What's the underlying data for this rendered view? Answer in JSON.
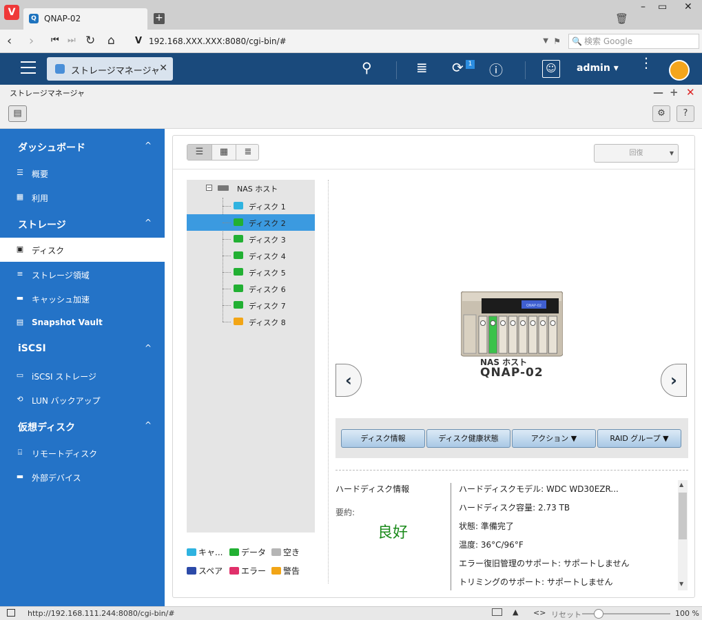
{
  "browser": {
    "tab_title": "QNAP-02",
    "url": "192.168.XXX.XXX:8080/cgi-bin/#",
    "search_placeholder": "検索 Google"
  },
  "topbar": {
    "app_tab_label": "ストレージマネージャ",
    "notification_count": "1",
    "user": "admin"
  },
  "app": {
    "title": "ストレージマネージャ"
  },
  "sidebar": {
    "sections": [
      {
        "label": "ダッシュボード",
        "items": [
          {
            "label": "概要",
            "icon": "list-icon"
          },
          {
            "label": "利用",
            "icon": "chart-icon"
          }
        ]
      },
      {
        "label": "ストレージ",
        "items": [
          {
            "label": "ディスク",
            "icon": "disk-icon"
          },
          {
            "label": "ストレージ領域",
            "icon": "storage-icon"
          },
          {
            "label": "キャッシュ加速",
            "icon": "cache-icon"
          },
          {
            "label": "Snapshot Vault",
            "icon": "snapshot-icon"
          }
        ]
      },
      {
        "label": "iSCSI",
        "items": [
          {
            "label": "iSCSI ストレージ",
            "icon": "iscsi-icon"
          },
          {
            "label": "LUN バックアップ",
            "icon": "backup-icon"
          }
        ]
      },
      {
        "label": "仮想ディスク",
        "items": [
          {
            "label": "リモートディスク",
            "icon": "remote-disk-icon"
          },
          {
            "label": "外部デバイス",
            "icon": "external-device-icon"
          }
        ]
      }
    ],
    "active": "ディスク"
  },
  "main": {
    "recover_label": "回復",
    "tree": {
      "root": "NAS ホスト",
      "disks": [
        {
          "label": "ディスク 1",
          "color": "#2fb3e0"
        },
        {
          "label": "ディスク 2",
          "color": "#22b033"
        },
        {
          "label": "ディスク 3",
          "color": "#22b033"
        },
        {
          "label": "ディスク 4",
          "color": "#22b033"
        },
        {
          "label": "ディスク 5",
          "color": "#22b033"
        },
        {
          "label": "ディスク 6",
          "color": "#22b033"
        },
        {
          "label": "ディスク 7",
          "color": "#22b033"
        },
        {
          "label": "ディスク 8",
          "color": "#f2a516"
        }
      ],
      "selected": "ディスク 2"
    },
    "legend": [
      {
        "label": "キャ...",
        "color": "#2fb3e0"
      },
      {
        "label": "データ",
        "color": "#22b033"
      },
      {
        "label": "空き",
        "color": "#b5b5b5"
      },
      {
        "label": "スペア",
        "color": "#2c4aa8"
      },
      {
        "label": "エラー",
        "color": "#e0306a"
      },
      {
        "label": "警告",
        "color": "#f2a516"
      }
    ],
    "nas": {
      "caption": "NAS ホスト",
      "name": "QNAP-02",
      "lcd_text": "QNAP-02"
    },
    "actions": [
      "ディスク情報",
      "ディスク健康状態",
      "アクション ▼",
      "RAID グループ ▼"
    ],
    "info": {
      "section_title": "ハードディスク情報",
      "summary_label": "要約:",
      "summary_value": "良好",
      "rows": [
        "ハードディスクモデル: WDC WD30EZR...",
        "ハードディスク容量: 2.73 TB",
        "状態: 準備完了",
        "温度: 36°C/96°F",
        "エラー復旧管理のサポート: サポートしません",
        "トリミングのサポート: サポートしません"
      ]
    }
  },
  "statusbar": {
    "url": "http://192.168.111.244:8080/cgi-bin/#",
    "reset_label": "リセット",
    "zoom": "100 %"
  }
}
